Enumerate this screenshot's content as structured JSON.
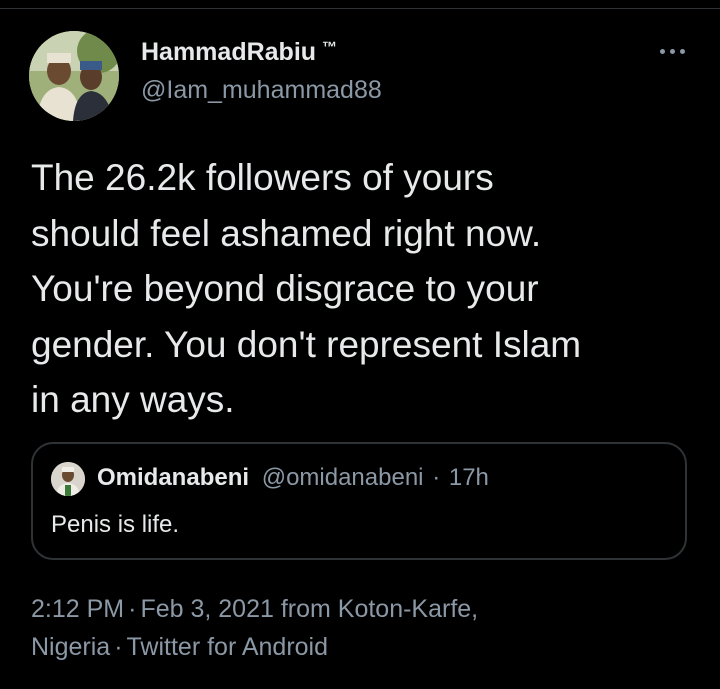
{
  "tweet": {
    "author": {
      "display_name": "HammadRabiu",
      "name_suffix": "™",
      "handle": "@Iam_muhammad88",
      "avatar_icon": "profile-photo"
    },
    "more_icon": "more-options-icon",
    "text_lines": [
      "The 26.2k followers of yours",
      "should feel ashamed right now.",
      "You're beyond disgrace to your",
      "gender. You don't represent Islam",
      "in any ways."
    ],
    "quoted": {
      "display_name": "Omidanabeni",
      "handle": "@omidanabeni",
      "separator": "·",
      "time": "17h",
      "text": "Penis is life.",
      "avatar_icon": "profile-photo"
    },
    "meta": {
      "time": "2:12 PM",
      "date": "Feb 3, 2021",
      "location_prefix": "from Koton-Karfe,",
      "location_rest": "Nigeria",
      "separator": "·",
      "source": "Twitter for Android"
    }
  },
  "colors": {
    "background": "#000000",
    "primary_text": "#e7e9ea",
    "secondary_text": "#8b98a5",
    "border": "#2f3336"
  }
}
